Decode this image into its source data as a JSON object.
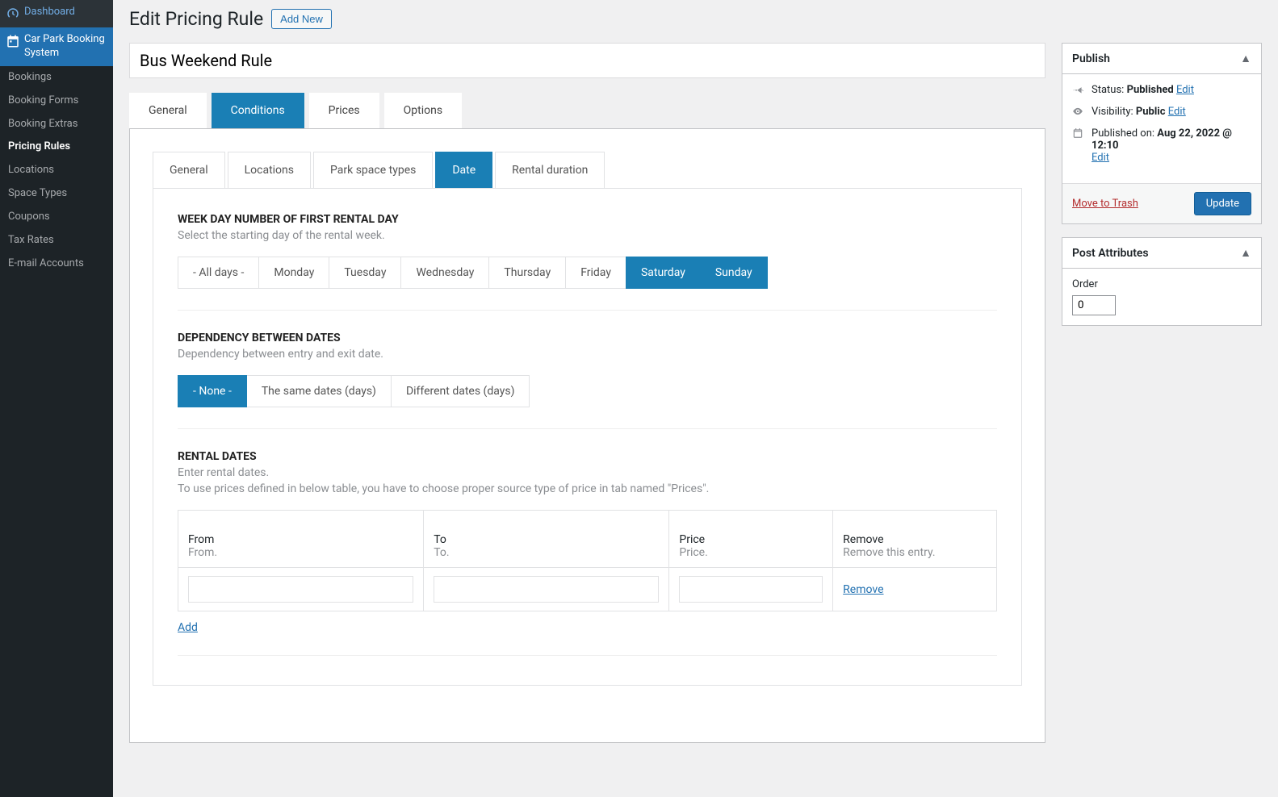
{
  "sidebar": {
    "items": [
      {
        "label": "Dashboard",
        "active": false,
        "hasIcon": true,
        "icon": "dashboard-icon"
      },
      {
        "label": "Car Park Booking System",
        "active": true,
        "hasIcon": true,
        "icon": "calendar-icon"
      }
    ],
    "submenu": [
      {
        "label": "Bookings",
        "current": false
      },
      {
        "label": "Booking Forms",
        "current": false
      },
      {
        "label": "Booking Extras",
        "current": false
      },
      {
        "label": "Pricing Rules",
        "current": true
      },
      {
        "label": "Locations",
        "current": false
      },
      {
        "label": "Space Types",
        "current": false
      },
      {
        "label": "Coupons",
        "current": false
      },
      {
        "label": "Tax Rates",
        "current": false
      },
      {
        "label": "E-mail Accounts",
        "current": false
      }
    ]
  },
  "header": {
    "title": "Edit Pricing Rule",
    "add_new_label": "Add New"
  },
  "title_field": {
    "value": "Bus Weekend Rule"
  },
  "main_tabs": [
    {
      "label": "General",
      "active": false
    },
    {
      "label": "Conditions",
      "active": true
    },
    {
      "label": "Prices",
      "active": false
    },
    {
      "label": "Options",
      "active": false
    }
  ],
  "sub_tabs": [
    {
      "label": "General",
      "active": false
    },
    {
      "label": "Locations",
      "active": false
    },
    {
      "label": "Park space types",
      "active": false
    },
    {
      "label": "Date",
      "active": true
    },
    {
      "label": "Rental duration",
      "active": false
    }
  ],
  "weekday_section": {
    "title": "WEEK DAY NUMBER OF FIRST RENTAL DAY",
    "desc": "Select the starting day of the rental week.",
    "options": [
      {
        "label": "- All days -",
        "active": false
      },
      {
        "label": "Monday",
        "active": false
      },
      {
        "label": "Tuesday",
        "active": false
      },
      {
        "label": "Wednesday",
        "active": false
      },
      {
        "label": "Thursday",
        "active": false
      },
      {
        "label": "Friday",
        "active": false
      },
      {
        "label": "Saturday",
        "active": true
      },
      {
        "label": "Sunday",
        "active": true
      }
    ]
  },
  "dependency_section": {
    "title": "DEPENDENCY BETWEEN DATES",
    "desc": "Dependency between entry and exit date.",
    "options": [
      {
        "label": "- None -",
        "active": true
      },
      {
        "label": "The same dates (days)",
        "active": false
      },
      {
        "label": "Different dates (days)",
        "active": false
      }
    ]
  },
  "rental_dates_section": {
    "title": "RENTAL DATES",
    "desc1": "Enter rental dates.",
    "desc2": "To use prices defined in below table, you have to choose proper source type of price in tab named \"Prices\".",
    "columns": {
      "from": {
        "header": "From",
        "desc": "From."
      },
      "to": {
        "header": "To",
        "desc": "To."
      },
      "price": {
        "header": "Price",
        "desc": "Price."
      },
      "remove": {
        "header": "Remove",
        "desc": "Remove this entry."
      }
    },
    "rows": [
      {
        "from": "",
        "to": "",
        "price": "",
        "remove_label": "Remove"
      }
    ],
    "add_label": "Add"
  },
  "publish_box": {
    "title": "Publish",
    "status_label": "Status:",
    "status_value": "Published",
    "visibility_label": "Visibility:",
    "visibility_value": "Public",
    "published_on_label": "Published on:",
    "published_on_value": "Aug 22, 2022 @ 12:10",
    "edit_label": "Edit",
    "trash_label": "Move to Trash",
    "update_label": "Update"
  },
  "attributes_box": {
    "title": "Post Attributes",
    "order_label": "Order",
    "order_value": "0"
  }
}
